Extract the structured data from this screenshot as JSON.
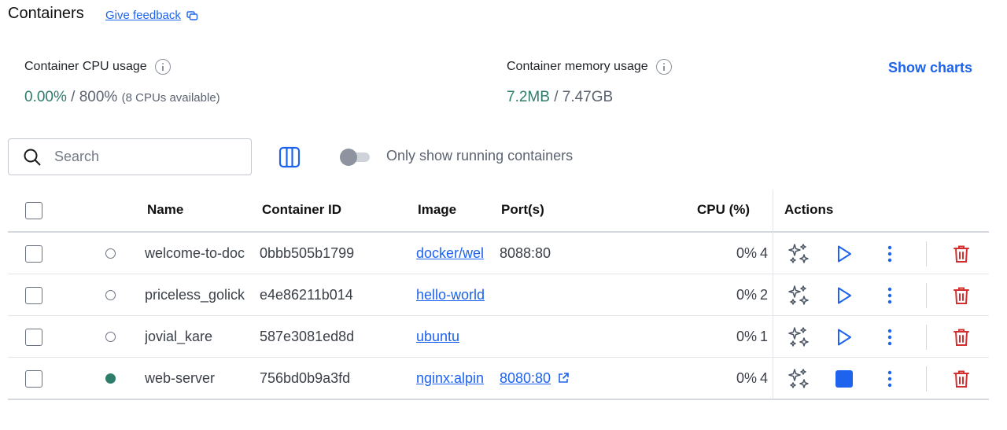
{
  "header": {
    "title": "Containers",
    "feedback_label": "Give feedback"
  },
  "stats": {
    "cpu": {
      "label": "Container CPU usage",
      "used": "0.00%",
      "separator": " / ",
      "total": "800%",
      "note": "(8 CPUs available)"
    },
    "memory": {
      "label": "Container memory usage",
      "used": "7.2MB",
      "separator": " / ",
      "total": "7.47GB"
    },
    "show_charts_label": "Show charts"
  },
  "toolbar": {
    "search_placeholder": "Search",
    "search_value": "",
    "toggle_label": "Only show running containers",
    "toggle_on": false
  },
  "table": {
    "headers": {
      "name": "Name",
      "container_id": "Container ID",
      "image": "Image",
      "ports": "Port(s)",
      "cpu": "CPU (%)",
      "actions": "Actions"
    },
    "rows": [
      {
        "status": "stopped",
        "name": "welcome-to-doc",
        "id": "0bbb505b1799",
        "image": "docker/wel",
        "ports": "8088:80",
        "port_link": false,
        "cpu": "0%",
        "cut": "4"
      },
      {
        "status": "stopped",
        "name": "priceless_golick",
        "id": "e4e86211b014",
        "image": "hello-world",
        "ports": "",
        "port_link": false,
        "cpu": "0%",
        "cut": "2"
      },
      {
        "status": "stopped",
        "name": "jovial_kare",
        "id": "587e3081ed8d",
        "image": "ubuntu",
        "ports": "",
        "port_link": false,
        "cpu": "0%",
        "cut": "1"
      },
      {
        "status": "running",
        "name": "web-server",
        "id": "756bd0b9a3fd",
        "image": "nginx:alpin",
        "ports": "8080:80",
        "port_link": true,
        "cpu": "0%",
        "cut": "4"
      }
    ]
  },
  "colors": {
    "accent": "#1d63ed",
    "running": "#2e7d6b",
    "danger": "#d32f2f",
    "muted": "#5c6370"
  },
  "icons": {
    "sparkle": "sparkle-icon",
    "start": "play-icon",
    "stop": "stop-icon",
    "more": "kebab-menu-icon",
    "delete": "trash-icon"
  }
}
